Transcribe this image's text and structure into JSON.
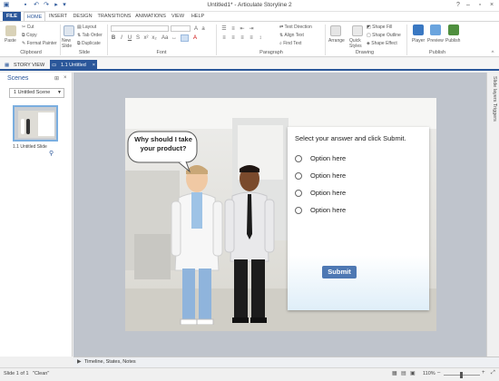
{
  "window": {
    "title": "Untitled1* - Articulate Storyline 2"
  },
  "ribbon_tabs": [
    "FILE",
    "HOME",
    "INSERT",
    "DESIGN",
    "TRANSITIONS",
    "ANIMATIONS",
    "VIEW",
    "HELP"
  ],
  "clipboard": {
    "paste": "Paste",
    "cut": "Cut",
    "copy": "Copy",
    "format_painter": "Format Painter",
    "label": "Clipboard"
  },
  "slide_group": {
    "new_slide": "New Slide",
    "layout": "Layout",
    "tab_order": "Tab Order",
    "duplicate": "Duplicate",
    "label": "Slide"
  },
  "font_group": {
    "label": "Font"
  },
  "paragraph_group": {
    "text_direction": "Text Direction",
    "align_text": "Align Text",
    "find_text": "Find Text",
    "label": "Paragraph"
  },
  "drawing_group": {
    "arrange": "Arrange",
    "quick_styles": "Quick Styles",
    "shape_fill": "Shape Fill",
    "shape_outline": "Shape Outline",
    "shape_effect": "Shape Effect",
    "label": "Drawing"
  },
  "publish_group": {
    "player": "Player",
    "preview": "Preview",
    "publish": "Publish",
    "label": "Publish"
  },
  "doc_tabs": {
    "story_view": "STORY VIEW",
    "slide_tab": "1.1 Untitled Sli..."
  },
  "scenes_panel": {
    "title": "Scenes",
    "dropdown_value": "1 Untitled Scene",
    "thumb_label": "1.1 Untitled Slide"
  },
  "slide": {
    "bubble_text": "Why should I take your product?",
    "question": "Select your answer and click Submit.",
    "options": [
      "Option here",
      "Option here",
      "Option here",
      "Option here"
    ],
    "submit_label": "Submit"
  },
  "right_panel": {
    "label": "Slide layers Triggers"
  },
  "timeline": {
    "label": "Timeline, States, Notes"
  },
  "status": {
    "slide_info": "Slide 1 of 1",
    "theme": "\"Clean\"",
    "zoom": "110%"
  },
  "colors": {
    "accent": "#2b579a",
    "submit": "#4e78b3"
  },
  "icons": [
    "save-icon",
    "undo-icon",
    "redo-icon",
    "minimize-icon",
    "restore-icon",
    "close-icon",
    "paste-icon",
    "player-icon",
    "preview-icon",
    "publish-icon",
    "story-view-icon",
    "radio-icon",
    "timeline-icon",
    "zoom-out-icon",
    "zoom-in-icon",
    "fit-icon"
  ]
}
